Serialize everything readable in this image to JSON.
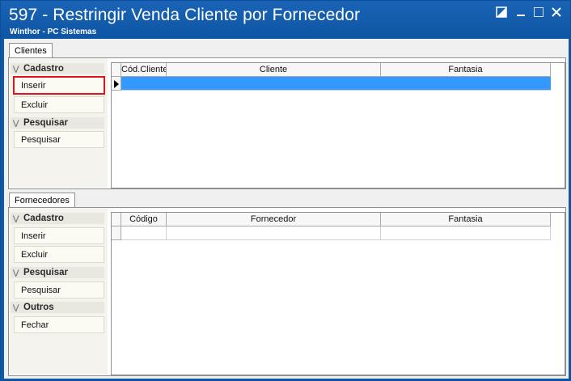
{
  "window": {
    "title": "597 - Restringir Venda Cliente por Fornecedor",
    "subtitle": "Winthor - PC Sistemas"
  },
  "clientes": {
    "tab_label": "Clientes",
    "groups": [
      {
        "header": "Cadastro",
        "buttons": [
          "Inserir",
          "Excluir"
        ]
      },
      {
        "header": "Pesquisar",
        "buttons": [
          "Pesquisar"
        ]
      }
    ],
    "columns": [
      "Cód.Cliente",
      "Cliente",
      "Fantasia"
    ],
    "selected_row_color": "#3399ff"
  },
  "fornecedores": {
    "tab_label": "Fornecedores",
    "groups": [
      {
        "header": "Cadastro",
        "buttons": [
          "Inserir",
          "Excluir"
        ]
      },
      {
        "header": "Pesquisar",
        "buttons": [
          "Pesquisar"
        ]
      },
      {
        "header": "Outros",
        "buttons": [
          "Fechar"
        ]
      }
    ],
    "columns": [
      "Código",
      "Fornecedor",
      "Fantasia"
    ]
  },
  "highlight_color": "#e0141e"
}
